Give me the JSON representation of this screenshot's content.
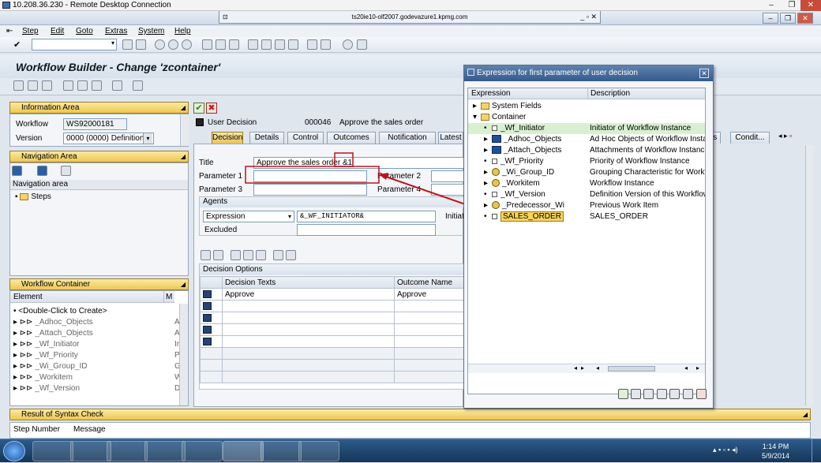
{
  "rdp": {
    "title": "10.208.36.230 - Remote Desktop Connection"
  },
  "sap_connection": {
    "host": "ts20ie10-olf2007.godevazure1.kpmg.com"
  },
  "menu": [
    "Step",
    "Edit",
    "Goto",
    "Extras",
    "System",
    "Help"
  ],
  "page_title": "Workflow Builder - Change 'zcontainer'",
  "info_area": {
    "header": "Information Area",
    "workflow_label": "Workflow",
    "workflow_value": "WS92000181",
    "version_label": "Version",
    "version_value": "0000 (0000) Definition"
  },
  "nav_area": {
    "header": "Navigation Area",
    "tree_header": "Navigation area",
    "steps_label": "Steps"
  },
  "wf_container": {
    "header": "Workflow Container",
    "col_element": "Element",
    "col_m": "M",
    "items": [
      {
        "name": "<Double-Click to Create>",
        "tag": ""
      },
      {
        "name": "_Adhoc_Objects",
        "tag": "A"
      },
      {
        "name": "_Attach_Objects",
        "tag": "A"
      },
      {
        "name": "_Wf_Initiator",
        "tag": "Ir"
      },
      {
        "name": "_Wf_Priority",
        "tag": "P"
      },
      {
        "name": "_Wi_Group_ID",
        "tag": "G"
      },
      {
        "name": "_Workitem",
        "tag": "W"
      },
      {
        "name": "_Wf_Version",
        "tag": "D"
      }
    ]
  },
  "syntax": {
    "header": "Result of Syntax Check",
    "col_step": "Step Number",
    "col_msg": "Message"
  },
  "step": {
    "type": "User Decision",
    "number": "000046",
    "desc": "Approve the sales order"
  },
  "tabs": [
    "Decision",
    "Details",
    "Control",
    "Outcomes",
    "Notification",
    "Latest"
  ],
  "right_tabs": [
    "ds",
    "Condit..."
  ],
  "decision": {
    "title_label": "Title",
    "title_value": "Approve the sales order &1",
    "param1_label": "Parameter 1",
    "param2_label": "Parameter 2",
    "param3_label": "Parameter 3",
    "param4_label": "Parameter 4",
    "param1_value": "",
    "agents_header": "Agents",
    "agent_type": "Expression",
    "agent_value": "&_WF_INITIATOR&",
    "initiator_label": "Initiat",
    "excluded_label": "Excluded",
    "options_header": "Decision Options",
    "col_texts": "Decision Texts",
    "col_outcome": "Outcome Name",
    "rows": [
      {
        "text": "Approve",
        "outcome": "Approve"
      },
      {
        "text": "",
        "outcome": ""
      },
      {
        "text": "",
        "outcome": ""
      },
      {
        "text": "",
        "outcome": ""
      },
      {
        "text": "",
        "outcome": ""
      }
    ]
  },
  "dialog": {
    "title": "Expression for first parameter of user decision",
    "col_expr": "Expression",
    "col_desc": "Description",
    "rows": [
      {
        "expr": "System Fields",
        "desc": "",
        "icon": "folder",
        "level": 0,
        "arrow": "right"
      },
      {
        "expr": "Container",
        "desc": "",
        "icon": "folder",
        "level": 0,
        "arrow": "down"
      },
      {
        "expr": "_Wf_Initiator",
        "desc": "Initiator of Workflow Instance",
        "icon": "elem",
        "level": 1,
        "arrow": "dot",
        "selected": true
      },
      {
        "expr": "_Adhoc_Objects",
        "desc": "Ad Hoc Objects of Workflow Insta",
        "icon": "table",
        "level": 1,
        "arrow": "right"
      },
      {
        "expr": "_Attach_Objects",
        "desc": "Attachments of Workflow Instanc",
        "icon": "table",
        "level": 1,
        "arrow": "right"
      },
      {
        "expr": "_Wf_Priority",
        "desc": "Priority of Workflow Instance",
        "icon": "elem",
        "level": 1,
        "arrow": "dot"
      },
      {
        "expr": "_Wi_Group_ID",
        "desc": "Grouping Characteristic for Workflo",
        "icon": "object",
        "level": 1,
        "arrow": "right"
      },
      {
        "expr": "_Workitem",
        "desc": "Workflow Instance",
        "icon": "object",
        "level": 1,
        "arrow": "right"
      },
      {
        "expr": "_Wf_Version",
        "desc": "Definition Version of this Workflow",
        "icon": "elem",
        "level": 1,
        "arrow": "dot"
      },
      {
        "expr": "_Predecessor_Wi",
        "desc": "Previous Work Item",
        "icon": "object",
        "level": 1,
        "arrow": "right"
      },
      {
        "expr": "SALES_ORDER",
        "desc": "SALES_ORDER",
        "icon": "elem",
        "level": 1,
        "arrow": "dot",
        "highlight": true
      }
    ]
  },
  "taskbar": {
    "time": "1:14 PM",
    "date": "5/9/2014"
  },
  "colors": {
    "accent": "#345a8d",
    "highlight_box": "#e8c24c",
    "annotation": "#c0101a"
  }
}
